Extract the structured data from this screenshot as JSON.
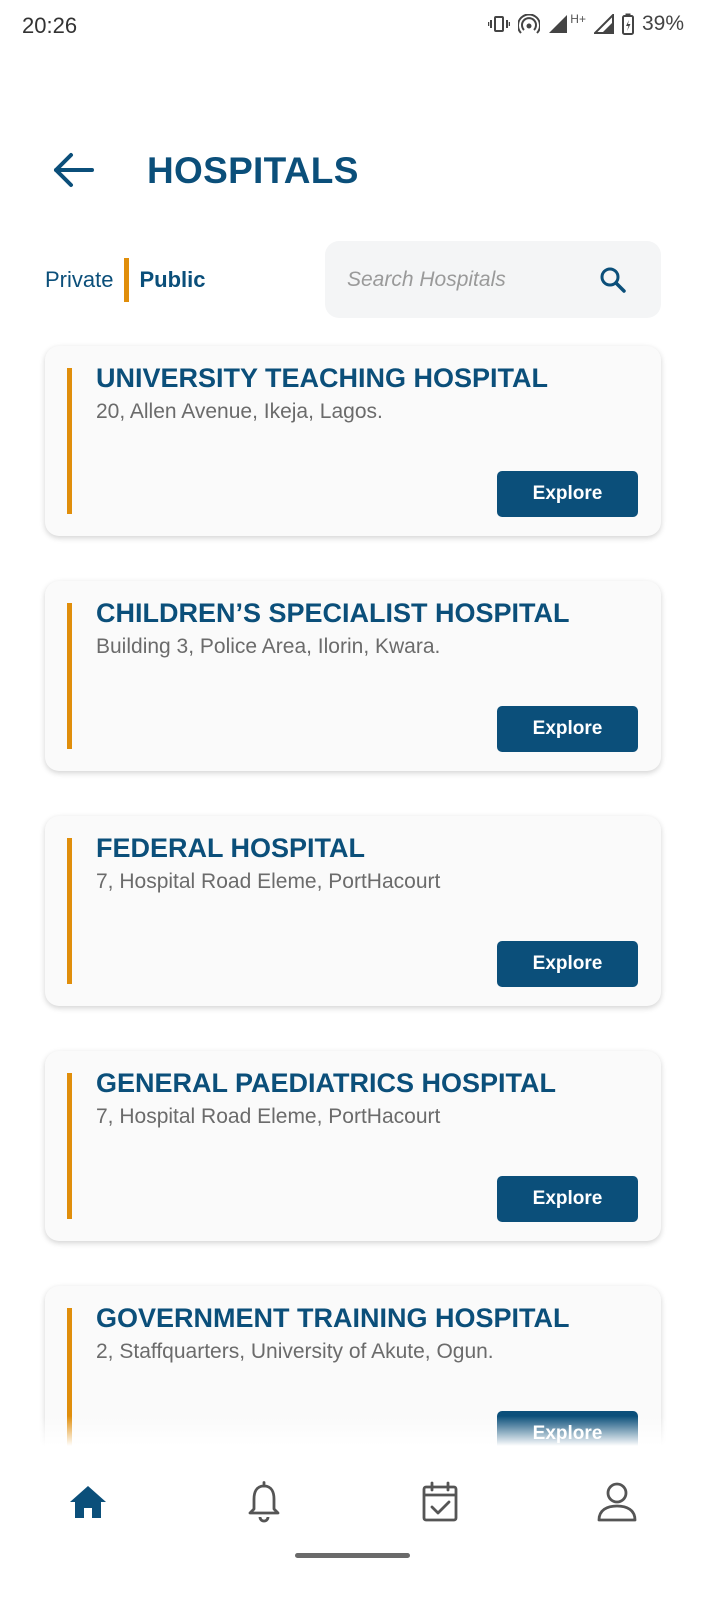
{
  "status_bar": {
    "time": "20:26",
    "network": "H+",
    "battery": "39%"
  },
  "header": {
    "title": "HOSPITALS"
  },
  "toggle": {
    "private_label": "Private",
    "public_label": "Public",
    "selected": "Public"
  },
  "search": {
    "placeholder": "Search Hospitals"
  },
  "hospitals": [
    {
      "name": "UNIVERSITY TEACHING HOSPITAL",
      "address": "20, Allen Avenue, Ikeja, Lagos.",
      "button": "Explore"
    },
    {
      "name": "CHILDREN’S SPECIALIST HOSPITAL",
      "address": "Building 3, Police Area, Ilorin, Kwara.",
      "button": "Explore"
    },
    {
      "name": "FEDERAL HOSPITAL",
      "address": "7, Hospital Road Eleme, PortHacourt",
      "button": "Explore"
    },
    {
      "name": "GENERAL PAEDIATRICS HOSPITAL",
      "address": "7, Hospital Road Eleme, PortHacourt",
      "button": "Explore"
    },
    {
      "name": "GOVERNMENT TRAINING HOSPITAL",
      "address": "2, Staffquarters, University of Akute, Ogun.",
      "button": "Explore"
    }
  ],
  "bottom_nav": {
    "items": [
      {
        "icon": "home-icon",
        "active": true
      },
      {
        "icon": "bell-icon",
        "active": false
      },
      {
        "icon": "calendar-check-icon",
        "active": false
      },
      {
        "icon": "profile-icon",
        "active": false
      }
    ]
  },
  "colors": {
    "primary": "#0b4f7a",
    "accent": "#e08e0b",
    "card_bg": "#fafafa",
    "muted_text": "#6b6b6b"
  }
}
